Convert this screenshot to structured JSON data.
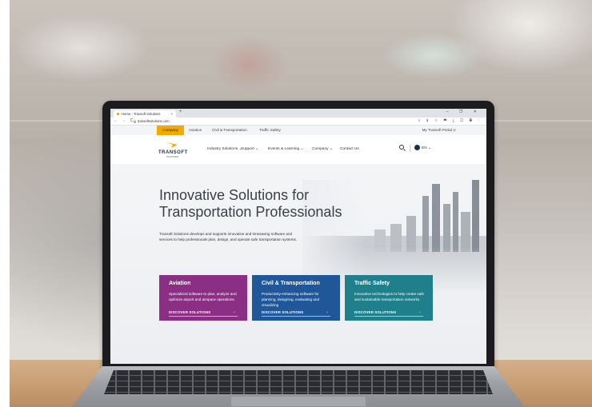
{
  "browser": {
    "tab_title": "Home - Transoft Solutions",
    "tab_close": "×",
    "new_tab": "+",
    "window_controls": "–  ❐  ✕",
    "nav_buttons": "← → C",
    "lock": "🔒",
    "url": "transoftsolutions.com",
    "extensions": "⌕ ⇪ ☆ ⚑ ⤓ ▢ ◉ ⋮"
  },
  "utility_bar": {
    "items": [
      "Company",
      "Aviation",
      "Civil & Transportation",
      "Traffic Safety"
    ],
    "portal": "My Transoft Portal ⊙"
  },
  "header": {
    "logo_text": "TRANSOFT",
    "logo_sub": "SOLUTIONS",
    "nav": [
      "Industry Solutions ⌄",
      "Support ⌄",
      "Events & Learning ⌄",
      "Company ⌄",
      "Contact Us"
    ],
    "language": "EN ⌄"
  },
  "hero": {
    "title_line1": "Innovative Solutions for",
    "title_line2": "Transportation Professionals",
    "description": "Transoft Solutions develops and supports innovative and timesaving software and services to help professionals plan, design, and operate safe transportation systems."
  },
  "cards": [
    {
      "title": "Aviation",
      "text": "Specialized software to plan, analyze and optimize airport and airspace operations.",
      "cta": "DISCOVER SOLUTIONS",
      "arrow": "→",
      "color": "#8a2f83"
    },
    {
      "title": "Civil & Transportation",
      "text": "Productivity-enhancing software for planning, designing, evaluating and visualizing",
      "cta": "DISCOVER SOLUTIONS",
      "arrow": "→",
      "color": "#1f5799"
    },
    {
      "title": "Traffic Safety",
      "text": "Innovative technologies to help create safe and sustainable transportation networks.",
      "cta": "DISCOVER SOLUTIONS",
      "arrow": "→",
      "color": "#1f7f8a"
    }
  ],
  "colors": {
    "accent_yellow": "#f2a900",
    "brand_navy": "#1e2b4d"
  }
}
